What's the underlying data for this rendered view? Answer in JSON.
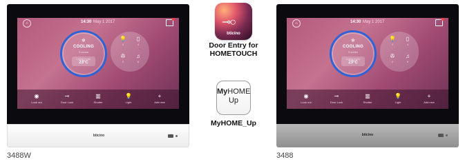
{
  "devices": [
    {
      "model": "3488W",
      "brand": "bticino",
      "screen": {
        "time": "14:30",
        "date": "May 1 2017",
        "thermostat": {
          "mode": "COOLING",
          "subtitle": "3 zones",
          "set_label": "Living room",
          "set_value": "23°C"
        },
        "favorites": [
          {
            "icon": "bulb-icon",
            "glyph": "💡",
            "count": "4"
          },
          {
            "icon": "tablet-icon",
            "glyph": "▯",
            "count": "4"
          },
          {
            "icon": "fan-icon",
            "glyph": "✇",
            "count": "2"
          },
          {
            "icon": "music-icon",
            "glyph": "♫",
            "count": "6"
          }
        ],
        "nav": [
          {
            "icon": "eye-icon",
            "glyph": "◉",
            "label": "Look out"
          },
          {
            "icon": "key-icon",
            "glyph": "⊸",
            "label": "Door Lock"
          },
          {
            "icon": "shutter-icon",
            "glyph": "▥",
            "label": "Shutter"
          },
          {
            "icon": "light-icon",
            "glyph": "💡",
            "label": "Light"
          },
          {
            "icon": "plus-icon",
            "glyph": "+",
            "label": "Add new"
          }
        ]
      }
    },
    {
      "model": "3488",
      "brand": "bticino",
      "screen": {
        "time": "14:30",
        "date": "May 1 2017",
        "thermostat": {
          "mode": "COOLING",
          "subtitle": "3 zones",
          "set_label": "Living room",
          "set_value": "23°C"
        },
        "favorites": [
          {
            "icon": "bulb-icon",
            "glyph": "💡",
            "count": "4"
          },
          {
            "icon": "tablet-icon",
            "glyph": "▯",
            "count": "4"
          },
          {
            "icon": "fan-icon",
            "glyph": "✇",
            "count": "2"
          },
          {
            "icon": "music-icon",
            "glyph": "♫",
            "count": "6"
          }
        ],
        "nav": [
          {
            "icon": "eye-icon",
            "glyph": "◉",
            "label": "Look out"
          },
          {
            "icon": "key-icon",
            "glyph": "⊸",
            "label": "Door Lock"
          },
          {
            "icon": "shutter-icon",
            "glyph": "▥",
            "label": "Shutter"
          },
          {
            "icon": "light-icon",
            "glyph": "💡",
            "label": "Light"
          },
          {
            "icon": "plus-icon",
            "glyph": "+",
            "label": "Add new"
          }
        ]
      }
    }
  ],
  "apps": {
    "door_entry": {
      "label_line1": "Door Entry for",
      "label_line2": "HOMETOUCH",
      "icon_brand": "bticino",
      "icon_glyph": "⊸○"
    },
    "myhome_up": {
      "label": "MyHOME_Up",
      "icon_text_my": "My",
      "icon_text_home": "HOME",
      "icon_text_up": "Up"
    }
  },
  "colors": {
    "screen_accent": "#2e63d6",
    "screen_background": "#b45a7a",
    "left_body": "#f4f4f4",
    "right_body": "#a8a8a8"
  }
}
